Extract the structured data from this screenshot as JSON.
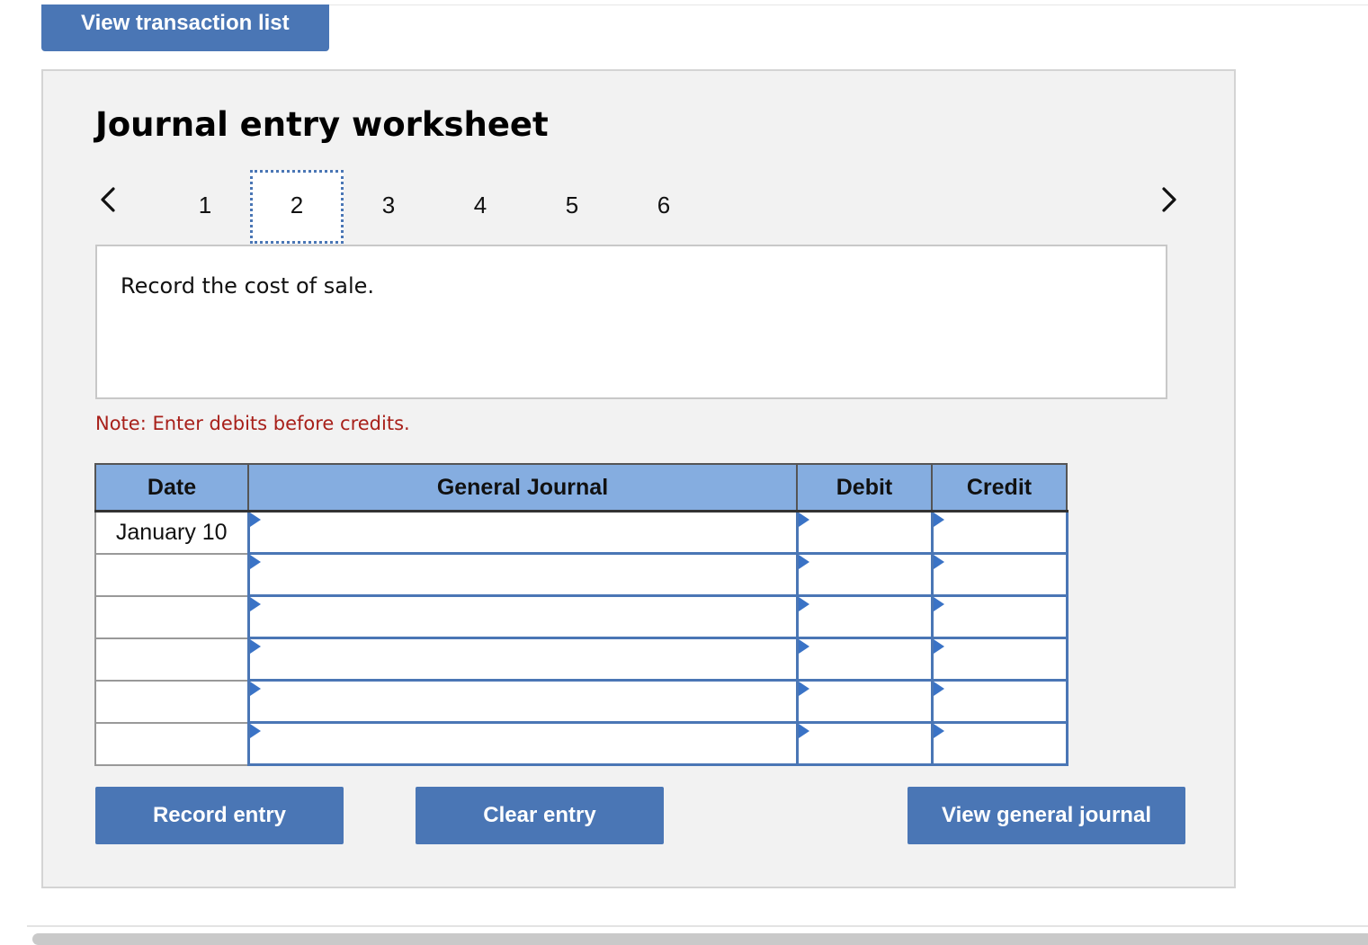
{
  "header": {
    "view_transaction_list_label": "View transaction list"
  },
  "worksheet": {
    "title": "Journal entry worksheet",
    "pager": {
      "prev_icon": "chevron-left-icon",
      "next_icon": "chevron-right-icon",
      "pages": [
        "1",
        "2",
        "3",
        "4",
        "5",
        "6"
      ],
      "active_page": "2"
    },
    "prompt": "Record the cost of sale.",
    "note": "Note: Enter debits before credits.",
    "table": {
      "columns": [
        "Date",
        "General Journal",
        "Debit",
        "Credit"
      ],
      "rows": [
        {
          "date": "January 10",
          "account": "",
          "debit": "",
          "credit": ""
        },
        {
          "date": "",
          "account": "",
          "debit": "",
          "credit": ""
        },
        {
          "date": "",
          "account": "",
          "debit": "",
          "credit": ""
        },
        {
          "date": "",
          "account": "",
          "debit": "",
          "credit": ""
        },
        {
          "date": "",
          "account": "",
          "debit": "",
          "credit": ""
        },
        {
          "date": "",
          "account": "",
          "debit": "",
          "credit": ""
        }
      ]
    },
    "buttons": {
      "record_entry": "Record entry",
      "clear_entry": "Clear entry",
      "view_general_journal": "View general journal"
    }
  },
  "colors": {
    "button_blue": "#4a76b5",
    "header_blue": "#85ade0",
    "note_red": "#a8201a",
    "panel_gray": "#f2f2f2"
  }
}
